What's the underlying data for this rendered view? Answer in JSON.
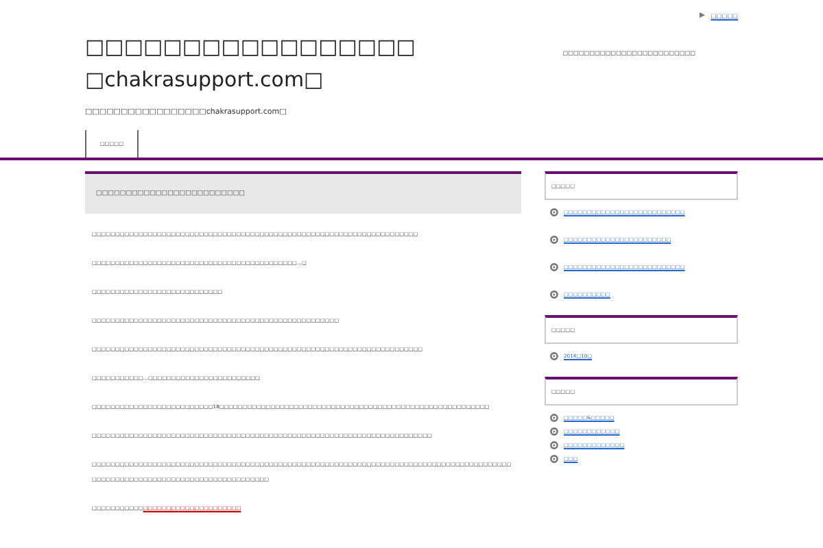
{
  "top_link": "□□□□□",
  "header": {
    "title_lines": [
      "□□□□□□□□□□□□□□□□□",
      "□chakrasupport.com□"
    ],
    "tagline": "□□□□□□□□□□□□□□□□□chakrasupport.com□",
    "description": "□□□□□□□□□□□□□□□□□□□□□□□□□"
  },
  "nav": [
    "□□□□□"
  ],
  "post": {
    "title": "□□□□□□□□□□□□□□□□□□□□□□□□□",
    "paragraphs": [
      {
        "text": "□□□□□□□□□□□□□□□□□□□□□□□□□□□□□□□□□□□□□□□□□□□□□□□□□□□□□□□□□□□□□□□□□□□□□□"
      },
      {
        "text": "□□□□□□□□□□□□□□□□□□□□□□□□□□□□□□□□□□□□□□□□□□□□…□"
      },
      {
        "text": "□□□□□□□□□□□□□□□□□□□□□□□□□□□□"
      },
      {
        "text": "□□□□□□□□□□□□□□□□□□□□□□□□□□□□□□□□□□□□□□□□□□□□□□□□□□□□□"
      },
      {
        "text": "□□□□□□□□□□□□□□□□□□□□□□□□□□□□□□□□□□□□□□□□□□□□□□□□□□□□□□□□□□□□□□□□□□□□□□□"
      },
      {
        "text": "□□□□□□□□□□□…□□□□□□□□□□□□□□□□□□□□□□□□"
      },
      {
        "text": "□□□□□□□□□□□□□□□□□□□□□□□□□□18□□□□□□□□□□□□□□□□□□□□□□□□□□□□□□□□□□□□□□□□□□□□□□□□□□□□□□□□□□"
      },
      {
        "text": "□□□□□□□□□□□□□□□□□□□□□□□□□□□□□□□□□□□□□□□□□□□□□□□□□□□□□□□□□□□□□□□□□□□□□□□□□"
      },
      {
        "text": "□□□□□□□□□□□□□□□□□□□□□□□□□□□□□□□□□□□□□□□□□□□□□□□□□□□□□□□□□□□□□□□□□□□□□□□□□□□□□□□□□□□□□□□□□□□□□□□□□□□□□□□□□□□□□□□□□□□□□□□□□□□□□□□□"
      },
      {
        "text": "□□□□□□□□□□□",
        "link": "□□□□□□□□□□□□□□□□□□□□□"
      }
    ]
  },
  "sidebar": [
    {
      "title": "□□□□□",
      "items": [
        "□□□□□□□□□□□□□□□□□□□□□□□□□□",
        "□□□□□□□□□□□□□□□□□□□□□□□",
        "□□□□□□□□□□□□□□□□□□□□□□□□□□",
        "□□□□□□□□□□"
      ]
    },
    {
      "title": "□□□□□",
      "items": [
        "2014□10□"
      ]
    },
    {
      "title": "□□□□□",
      "items": [
        "□□□□□&□□□□□",
        "□□□□□□□□□□□□",
        "□□□□□□□□□□□□□",
        "□□□"
      ]
    }
  ]
}
